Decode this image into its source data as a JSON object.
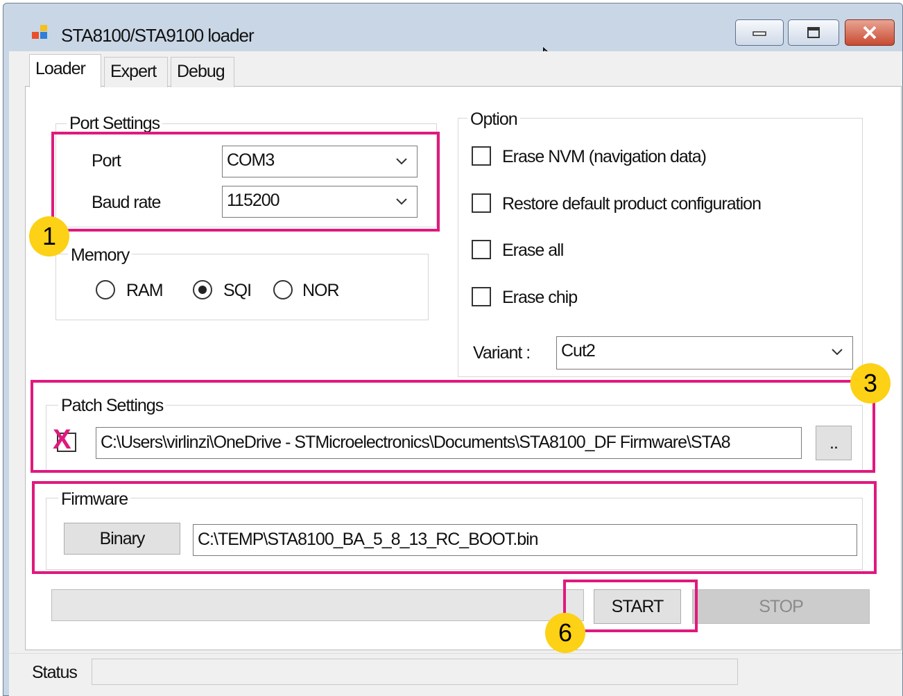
{
  "window": {
    "title": "STA8100/STA9100 loader"
  },
  "tabs": [
    {
      "label": "Loader"
    },
    {
      "label": "Expert"
    },
    {
      "label": "Debug"
    }
  ],
  "port_settings": {
    "legend": "Port Settings",
    "port_label": "Port",
    "port_value": "COM3",
    "baud_label": "Baud rate",
    "baud_value": "115200"
  },
  "memory": {
    "legend": "Memory",
    "options": [
      {
        "label": "RAM",
        "selected": false
      },
      {
        "label": "SQI",
        "selected": true
      },
      {
        "label": "NOR",
        "selected": false
      }
    ]
  },
  "option": {
    "legend": "Option",
    "checkboxes": [
      {
        "label": "Erase NVM (navigation data)",
        "checked": false
      },
      {
        "label": "Restore default product configuration",
        "checked": false
      },
      {
        "label": "Erase all",
        "checked": false
      },
      {
        "label": "Erase chip",
        "checked": false
      }
    ],
    "variant_label": "Variant :",
    "variant_value": "Cut2"
  },
  "patch": {
    "legend": "Patch Settings",
    "path": "C:\\Users\\virlinzi\\OneDrive - STMicroelectronics\\Documents\\STA8100_DF Firmware\\STA8",
    "browse_label": ".."
  },
  "firmware": {
    "legend": "Firmware",
    "binary_label": "Binary",
    "path": "C:\\TEMP\\STA8100_BA_5_8_13_RC_BOOT.bin"
  },
  "actions": {
    "start_label": "START",
    "stop_label": "STOP"
  },
  "status": {
    "label": "Status"
  },
  "annotations": {
    "badge1": "1",
    "badge3": "3",
    "badge6": "6",
    "x_mark": "X"
  },
  "colors": {
    "highlight": "#e0197d",
    "badge": "#fcd116",
    "close_button": "#c84a31"
  }
}
